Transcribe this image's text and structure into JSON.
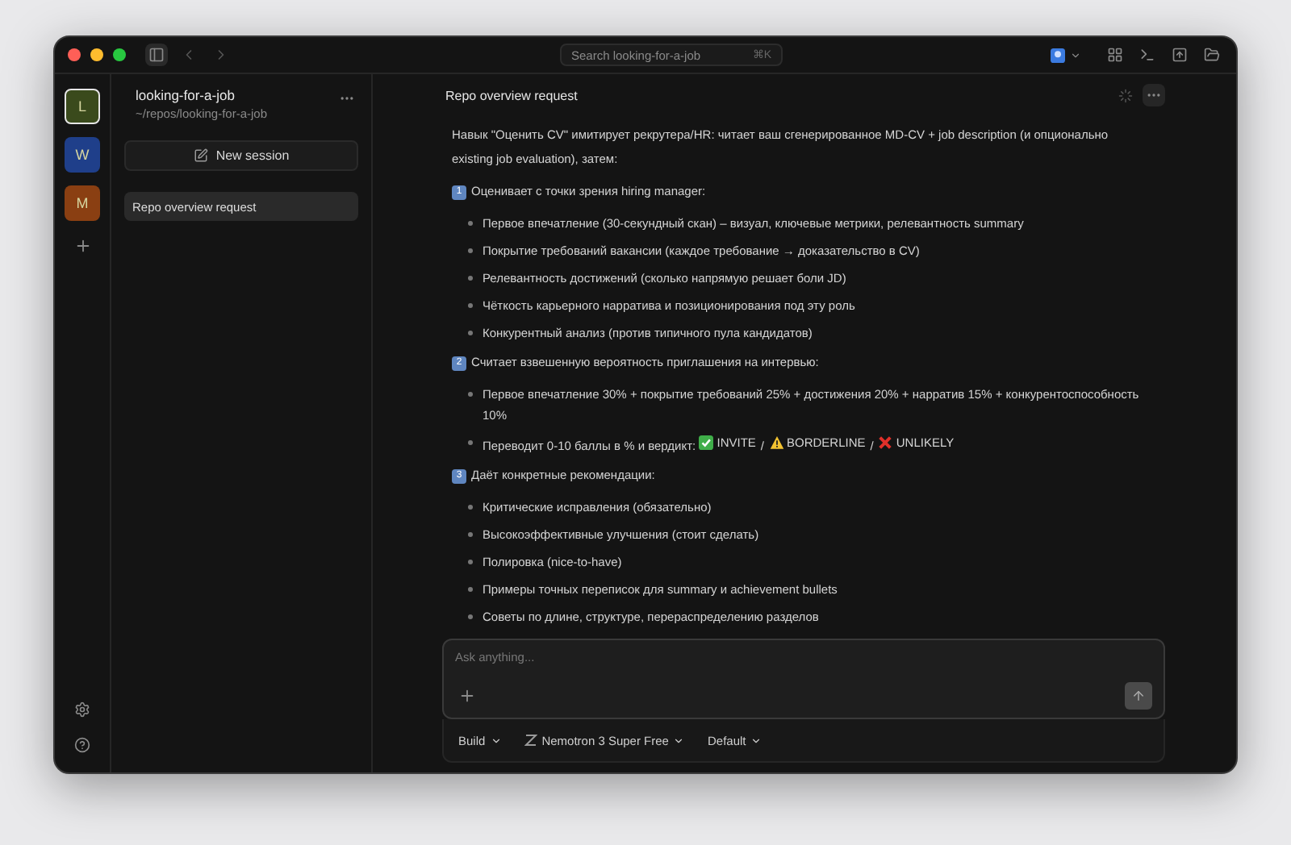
{
  "titlebar": {
    "search": {
      "placeholder": "Search looking-for-a-job",
      "shortcut": "⌘K"
    }
  },
  "rail": {
    "workspaces": [
      {
        "letter": "L",
        "color": "#3a4a1c",
        "selected": true
      },
      {
        "letter": "W",
        "color": "#1f3f8a",
        "selected": false
      },
      {
        "letter": "M",
        "color": "#8a3f12",
        "selected": false
      }
    ]
  },
  "sidebar": {
    "project": "looking-for-a-job",
    "path": "~/repos/looking-for-a-job",
    "new_session": "New session",
    "sessions": [
      {
        "label": "Repo overview request",
        "selected": true
      }
    ]
  },
  "chat": {
    "title": "Repo overview request",
    "intro": "Навык \"Оценить CV\" имитирует рекрутера/HR: читает ваш сгенерированное MD-CV + job description (и опционально existing job evaluation), затем:",
    "sections": [
      {
        "number": "1",
        "heading": "Оценивает с точки зрения hiring manager:",
        "items": [
          {
            "text": "Первое впечатление (30-секундный скан) – визуал, ключевые метрики, релевантность summary"
          },
          {
            "text": "Покрытие требований вакансии (каждое требование → доказательство в CV)"
          },
          {
            "text": "Релевантность достижений (сколько напрямую решает боли JD)"
          },
          {
            "text": "Чёткость карьерного нарратива и позиционирования под эту роль"
          },
          {
            "text": "Конкурентный анализ (против типичного пула кандидатов)"
          }
        ]
      },
      {
        "number": "2",
        "heading": "Считает взвешенную вероятность приглашения на интервью:",
        "items": [
          {
            "text": "Первое впечатление 30% + покрытие требований 25% + достижения 20% + нарратив 15% + конкурентоспособность 10%"
          },
          {
            "text": "Переводит 0-10 баллы в % и вердикт:",
            "separator": "/",
            "verdicts": [
              {
                "kind": "check",
                "label": "INVITE"
              },
              {
                "kind": "warning",
                "label": "BORDERLINE"
              },
              {
                "kind": "cross",
                "label": "UNLIKELY"
              }
            ]
          }
        ]
      },
      {
        "number": "3",
        "heading": "Даёт конкретные рекомендации:",
        "items": [
          {
            "text": "Критические исправления (обязательно)"
          },
          {
            "text": "Высокоэффективные улучшения (стоит сделать)"
          },
          {
            "text": "Полировка (nice-to-have)"
          },
          {
            "text": "Примеры точных переписок для summary и achievement bullets"
          },
          {
            "text": "Советы по длине, структуре, перераспределению разделов"
          }
        ]
      }
    ]
  },
  "composer": {
    "placeholder": "Ask anything...",
    "mode": "Build",
    "model": "Nemotron 3 Super Free",
    "variant": "Default"
  }
}
